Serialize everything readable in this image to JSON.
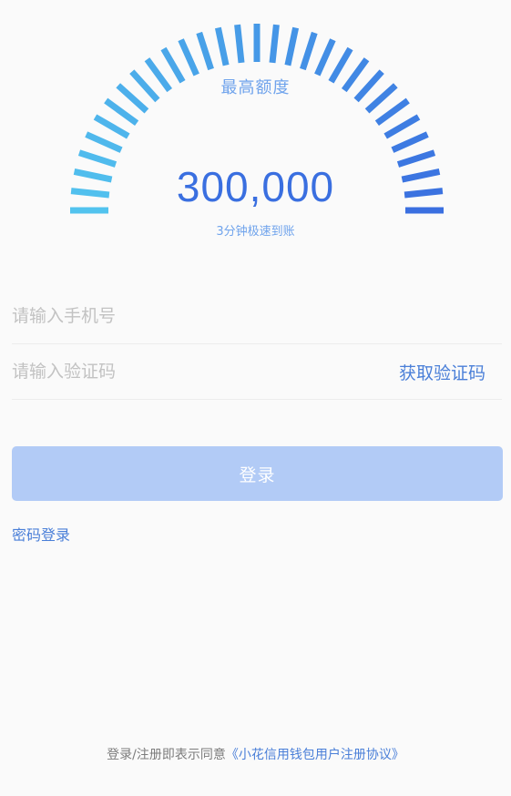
{
  "gauge": {
    "title": "最高额度",
    "amount": "300,000",
    "subtitle": "3分钟极速到账",
    "colors": {
      "start": "#52c3ee",
      "end": "#3a6fe0"
    }
  },
  "form": {
    "phone_placeholder": "请输入手机号",
    "code_placeholder": "请输入验证码",
    "get_code_label": "获取验证码",
    "login_label": "登录",
    "password_login_label": "密码登录"
  },
  "footer": {
    "agreement_prefix": "登录/注册即表示同意",
    "agreement_link": "《小花信用钱包用户注册协议》"
  }
}
